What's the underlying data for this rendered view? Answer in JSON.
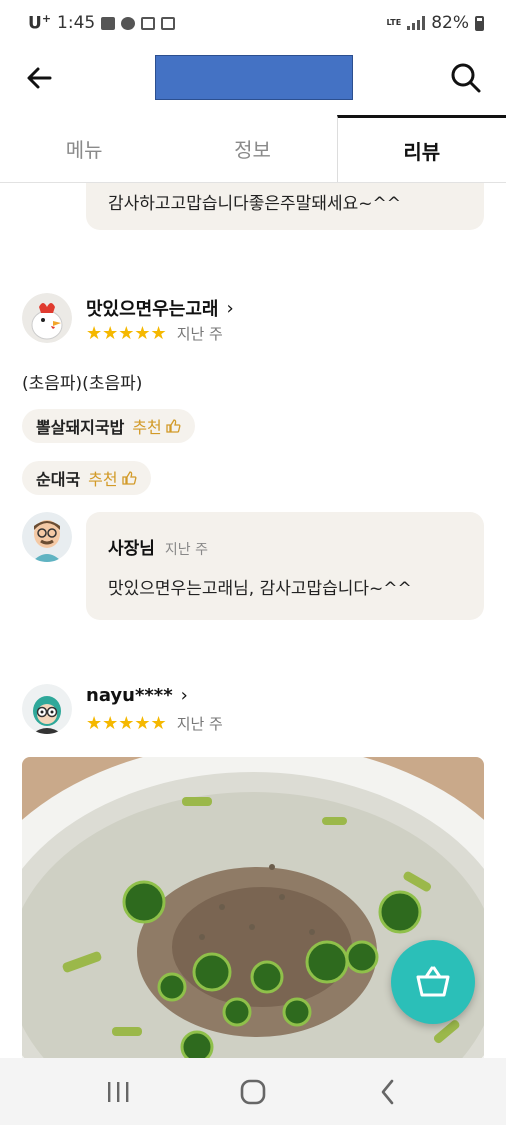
{
  "status_bar": {
    "carrier": "U",
    "carrier_sup": "+",
    "time": "1:45",
    "network": "LTE",
    "battery": "82%"
  },
  "tabs": [
    {
      "label": "메뉴"
    },
    {
      "label": "정보"
    },
    {
      "label": "리뷰"
    }
  ],
  "reviews": [
    {
      "reply_text": "감사하고고맙습니다좋은주말돼세요~^^"
    },
    {
      "nickname": "맛있으면우는고래",
      "stars": "★★★★★",
      "date": "지난 주",
      "text": "(초음파)(초음파)",
      "chips": [
        {
          "menu": "뽈살돼지국밥",
          "rec": "추천"
        },
        {
          "menu": "순대국",
          "rec": "추천"
        }
      ],
      "owner": {
        "name": "사장님",
        "date": "지난 주",
        "text": "맛있으면우는고래님, 감사고맙습니다~^^"
      }
    },
    {
      "nickname": "nayu****",
      "stars": "★★★★★",
      "date": "지난 주"
    }
  ],
  "colors": {
    "accent_teal": "#2bbfb8",
    "star": "#f5b800",
    "recommend": "#d29a28"
  }
}
